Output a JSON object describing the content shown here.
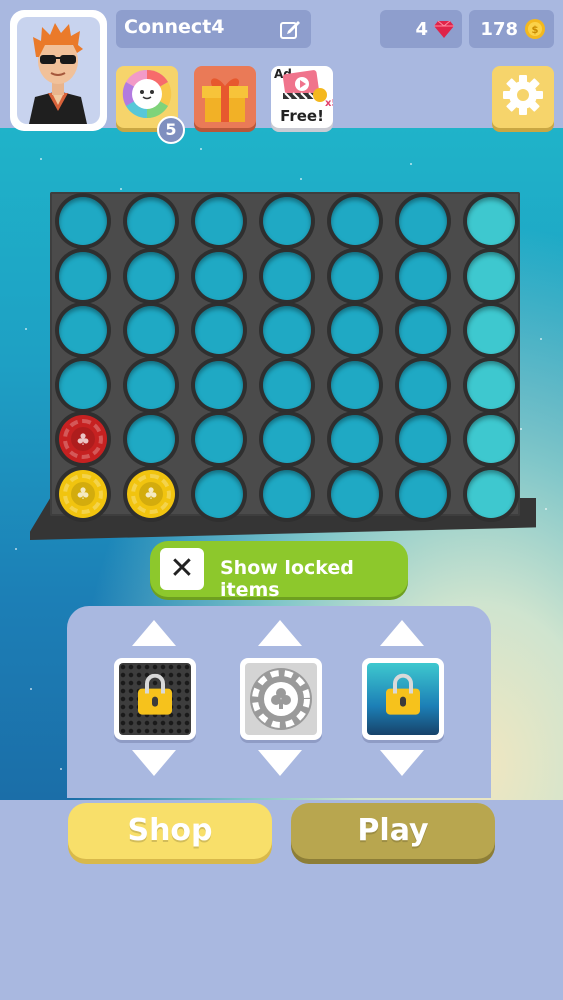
{
  "header": {
    "player_name": "Connect4",
    "gems": "4",
    "coins": "178",
    "wheel_badge": "5",
    "ad_tile": {
      "ad_label": "Ad",
      "multiplier": "x5",
      "free_label": "Free!"
    }
  },
  "board": {
    "rows": 6,
    "cols": 7,
    "pieces": [
      {
        "row": 5,
        "col": 1,
        "color": "red"
      },
      {
        "row": 6,
        "col": 1,
        "color": "yellow"
      },
      {
        "row": 6,
        "col": 2,
        "color": "yellow"
      }
    ]
  },
  "locked_toggle": {
    "label": "Show locked items",
    "checked_symbol": "✕"
  },
  "selectors": [
    {
      "name": "board-style",
      "locked": true
    },
    {
      "name": "chip-style",
      "locked": false
    },
    {
      "name": "background-style",
      "locked": true
    }
  ],
  "buttons": {
    "shop_label": "Shop",
    "play_label": "Play"
  },
  "colors": {
    "red_chip": "#c62121",
    "yellow_chip": "#f1c40f",
    "toggle_green": "#8dc82c",
    "shop_yellow": "#f8df6a",
    "play_olive": "#b8a64f"
  },
  "icons": [
    "edit-icon",
    "gem-icon",
    "coin-icon",
    "prize-wheel-icon",
    "gift-icon",
    "video-ad-icon",
    "gear-icon",
    "close-icon",
    "arrow-up-icon",
    "arrow-down-icon",
    "lock-icon"
  ]
}
